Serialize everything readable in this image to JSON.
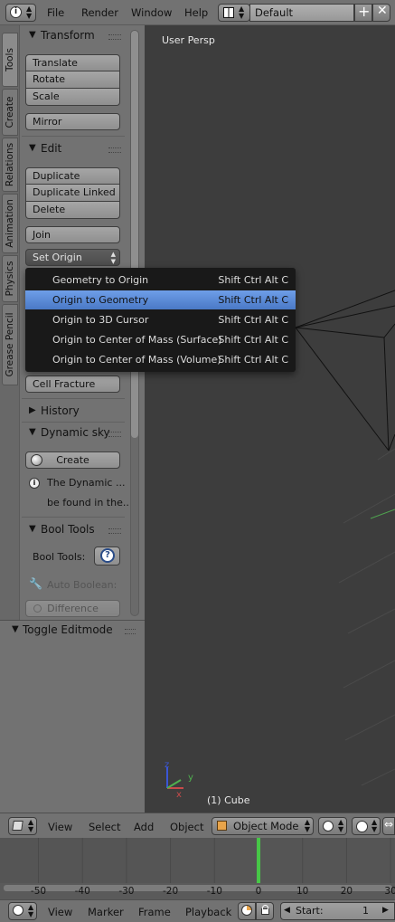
{
  "topbar": {
    "menus": [
      "File",
      "Render",
      "Window",
      "Help"
    ],
    "layout_value": "Default"
  },
  "tabs": [
    "Tools",
    "Create",
    "Relations",
    "Animation",
    "Physics",
    "Grease Pencil"
  ],
  "toolshelf": {
    "transform": {
      "title": "Transform",
      "buttons": [
        "Translate",
        "Rotate",
        "Scale"
      ],
      "mirror": "Mirror"
    },
    "edit": {
      "title": "Edit",
      "buttons": [
        "Duplicate",
        "Duplicate Linked",
        "Delete"
      ],
      "join": "Join",
      "set_origin": "Set Origin",
      "cell_fracture": "Cell Fracture"
    },
    "history": {
      "title": "History"
    },
    "dynamic_sky": {
      "title": "Dynamic sky",
      "create": "Create",
      "info1": "The Dynamic ...",
      "info2": "be found in the..."
    },
    "bool_tools": {
      "title": "Bool Tools",
      "label": "Bool Tools:",
      "help": "?",
      "auto_boolean": "Auto Boolean:",
      "difference": "Difference"
    },
    "toggle_editmode": {
      "title": "Toggle Editmode"
    }
  },
  "origin_menu": {
    "items": [
      {
        "label": "Geometry to Origin",
        "shortcut": "Shift Ctrl Alt C"
      },
      {
        "label": "Origin to Geometry",
        "shortcut": "Shift Ctrl Alt C"
      },
      {
        "label": "Origin to 3D Cursor",
        "shortcut": "Shift Ctrl Alt C"
      },
      {
        "label": "Origin to Center of Mass (Surface)",
        "shortcut": "Shift Ctrl Alt C"
      },
      {
        "label": "Origin to Center of Mass (Volume)",
        "shortcut": "Shift Ctrl Alt C"
      }
    ],
    "highlighted_index": 1
  },
  "viewport": {
    "view_label": "User Persp",
    "object_label": "(1) Cube",
    "axis": {
      "x": "x",
      "y": "y",
      "z": "z"
    }
  },
  "view3d_header": {
    "menus": [
      "View",
      "Select",
      "Add",
      "Object"
    ],
    "mode": "Object Mode"
  },
  "timeline": {
    "ruler": [
      "-50",
      "-40",
      "-30",
      "-20",
      "-10",
      "0",
      "10",
      "20",
      "30"
    ],
    "current_frame": 0
  },
  "timeline_header": {
    "menus": [
      "View",
      "Marker",
      "Frame",
      "Playback"
    ],
    "start_label": "Start:",
    "start_value": "1"
  },
  "colors": {
    "highlight": "#5680d4",
    "frame_cursor": "#47c747",
    "viewport_bg": "#3d3d3d",
    "panel_bg": "#727272"
  }
}
